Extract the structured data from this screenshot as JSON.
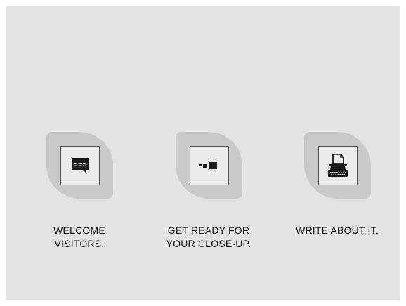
{
  "features": [
    {
      "icon": "chat-bubble-icon",
      "caption": "WELCOME\nVISITORS."
    },
    {
      "icon": "toggle-camera-icon",
      "caption": "GET READY FOR\nYOUR CLOSE-UP."
    },
    {
      "icon": "typewriter-icon",
      "caption": "WRITE ABOUT IT."
    }
  ],
  "colors": {
    "panel": "#e3e3e3",
    "leaf": "#c9c9c9",
    "icon_box": "#ebebeb",
    "icon": "#1a1a1a"
  }
}
